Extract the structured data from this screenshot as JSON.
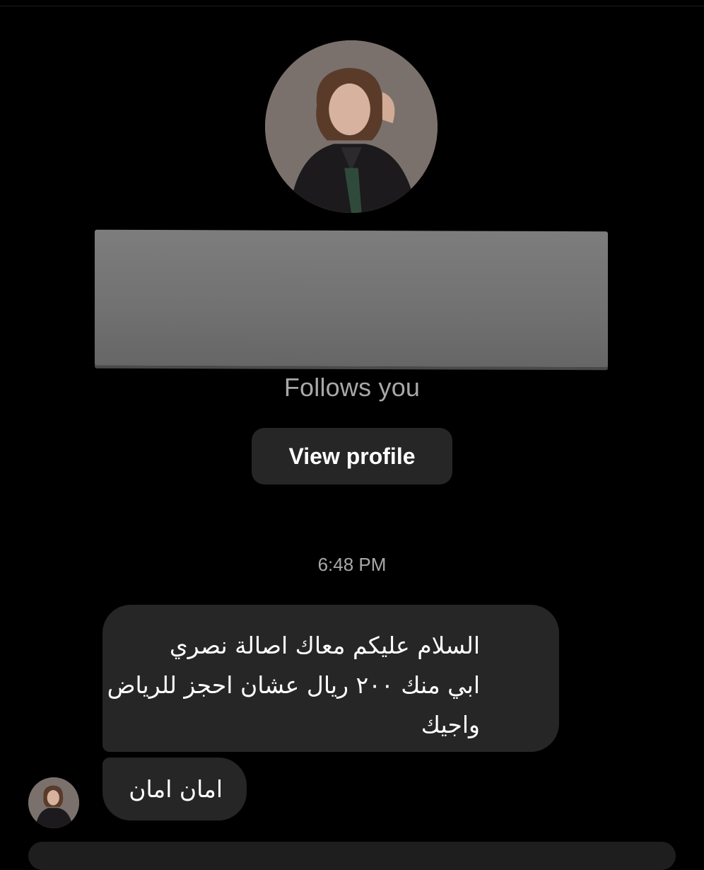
{
  "profile": {
    "avatar_icon": "profile-photo-icon",
    "name_hidden": true,
    "follows_label": "Follows you",
    "view_profile_label": "View profile"
  },
  "conversation": {
    "timestamp": "6:48 PM",
    "messages": [
      {
        "lines": [
          "السلام عليكم معاك اصالة نصري",
          "ابي منك ٢٠٠ ريال عشان احجز للرياض",
          "واجيك"
        ]
      },
      {
        "text": "امان امان"
      }
    ],
    "sender_avatar_icon": "sender-avatar-icon"
  },
  "colors": {
    "background": "#000000",
    "bubble": "#262626",
    "secondary_text": "#a8a8a8",
    "redaction": "#767676"
  }
}
